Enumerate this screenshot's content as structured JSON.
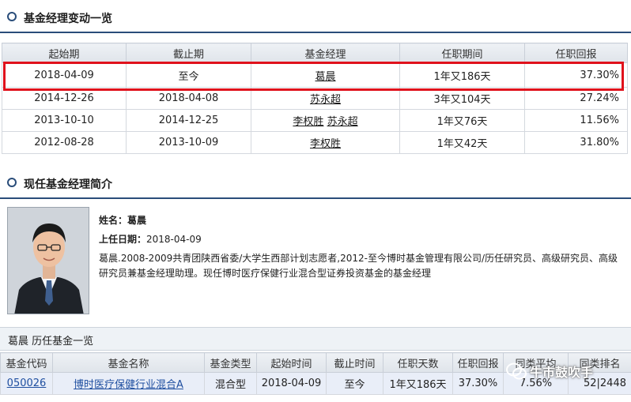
{
  "changes_section": {
    "title": "基金经理变动一览"
  },
  "changes_table": {
    "headers": [
      "起始期",
      "截止期",
      "基金经理",
      "任职期间",
      "任职回报"
    ],
    "rows": [
      {
        "start": "2018-04-09",
        "end": "至今",
        "managers": [
          "葛晨"
        ],
        "tenure": "1年又186天",
        "return": "37.30%"
      },
      {
        "start": "2014-12-26",
        "end": "2018-04-08",
        "managers": [
          "苏永超"
        ],
        "tenure": "3年又104天",
        "return": "27.24%"
      },
      {
        "start": "2013-10-10",
        "end": "2014-12-25",
        "managers": [
          "李权胜",
          "苏永超"
        ],
        "tenure": "1年又76天",
        "return": "11.56%"
      },
      {
        "start": "2012-08-28",
        "end": "2013-10-09",
        "managers": [
          "李权胜"
        ],
        "tenure": "1年又42天",
        "return": "31.80%"
      }
    ]
  },
  "profile_section": {
    "title": "现任基金经理简介"
  },
  "profile": {
    "name_label": "姓名：",
    "name": "葛晨",
    "date_label": "上任日期：",
    "date": "2018-04-09",
    "bio_line1": "葛晨.2008-2009共青团陕西省委/大学生西部计划志愿者,2012-至今博时基金管理有限公司/历任研究员、高级研究员、高级",
    "bio_line2": "研究员兼基金经理助理。现任博时医疗保健行业混合型证券投资基金的基金经理"
  },
  "history_section": {
    "title": "葛晨 历任基金一览"
  },
  "history_table": {
    "headers": [
      "基金代码",
      "基金名称",
      "基金类型",
      "起始时间",
      "截止时间",
      "任职天数",
      "任职回报",
      "同类平均",
      "同类排名"
    ],
    "rows": [
      {
        "code": "050026",
        "name": "博时医疗保健行业混合A",
        "type": "混合型",
        "start": "2018-04-09",
        "end": "至今",
        "days": "1年又186天",
        "return": "37.30%",
        "avg": "7.56%",
        "rank": "52|2448"
      }
    ]
  },
  "watermark": {
    "text": "牛市鼓吹手"
  },
  "colors": {
    "accent": "#2a4d7a",
    "positive": "#c0272d",
    "highlight": "#e0121c"
  }
}
